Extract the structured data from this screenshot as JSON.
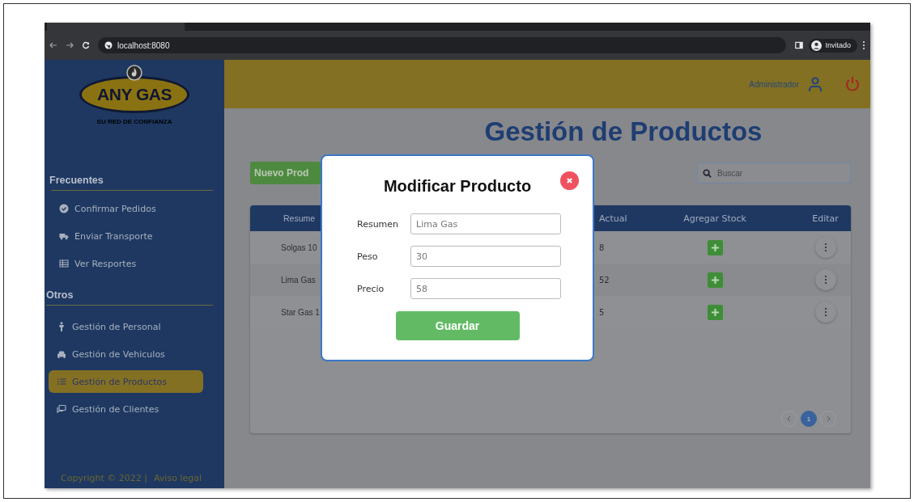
{
  "browser": {
    "url": "localhost:8080",
    "profile": "Invitado"
  },
  "header": {
    "user": "Administrador"
  },
  "logo": {
    "name": "ANY GAS",
    "slogan": "SU RED DE CONFIANZA"
  },
  "sidebar": {
    "sections": [
      {
        "title": "Frecuentes",
        "items": [
          {
            "label": "Confirmar Pedidos",
            "selected": false
          },
          {
            "label": "Enviar Transporte",
            "selected": false
          },
          {
            "label": "Ver Resportes",
            "selected": false
          }
        ]
      },
      {
        "title": "Otros",
        "items": [
          {
            "label": "Gestión de Personal",
            "selected": false
          },
          {
            "label": "Gestión de Vehiculos",
            "selected": false
          },
          {
            "label": "Gestión de Productos",
            "selected": true
          },
          {
            "label": "Gestión de Clientes",
            "selected": false
          }
        ]
      }
    ],
    "footer": {
      "copyright": "Copyright © 2022 |",
      "link": "Aviso legal"
    }
  },
  "page": {
    "title": "Gestión de Productos",
    "new_button": "Nuevo Prod",
    "search": {
      "placeholder": "Buscar"
    }
  },
  "table": {
    "columns": [
      "Resume",
      "Actual",
      "Agregar Stock",
      "Editar"
    ],
    "rows": [
      {
        "resumen": "Solgas 10",
        "stock": "8"
      },
      {
        "resumen": "Lima Gas",
        "stock": "52"
      },
      {
        "resumen": "Star Gas 1",
        "stock": "5"
      }
    ]
  },
  "pagination": [
    {
      "label": "1",
      "selected": true
    }
  ],
  "modal": {
    "title": "Modificar Producto",
    "fields": [
      {
        "label": "Resumen",
        "value": "Lima Gas"
      },
      {
        "label": "Peso",
        "value": "30"
      },
      {
        "label": "Precio",
        "value": "58"
      }
    ],
    "button": "Guardar"
  }
}
